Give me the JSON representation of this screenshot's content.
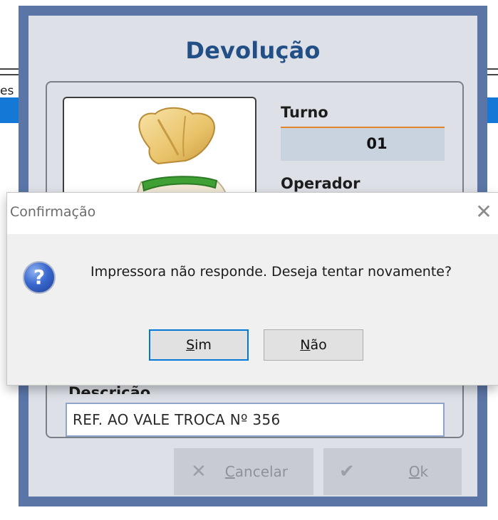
{
  "background_app": {
    "partial_text": "es"
  },
  "window": {
    "title": "Devolução",
    "image_alt": "money-bag-icon",
    "turno": {
      "label": "Turno",
      "value": "01"
    },
    "operador": {
      "label": "Operador"
    },
    "descricao": {
      "label": "Descrição",
      "value": "REF. AO VALE TROCA Nº 356"
    },
    "buttons": {
      "cancel": {
        "icon": "x-icon",
        "mnemonic": "C",
        "rest": "ancelar"
      },
      "ok": {
        "icon": "check-icon",
        "mnemonic": "O",
        "rest": "k"
      }
    }
  },
  "dialog": {
    "title": "Confirmação",
    "close": "✕",
    "icon": "question-icon",
    "icon_glyph": "?",
    "message": "Impressora não responde. Deseja tentar novamente?",
    "yes": {
      "mnemonic": "S",
      "rest": "im"
    },
    "no": {
      "mnemonic": "N",
      "rest": "ão"
    }
  },
  "colors": {
    "window_frame": "#5b76a6",
    "title": "#214f86",
    "accent_orange": "#e3842f",
    "dialog_default_border": "#0078d7"
  }
}
